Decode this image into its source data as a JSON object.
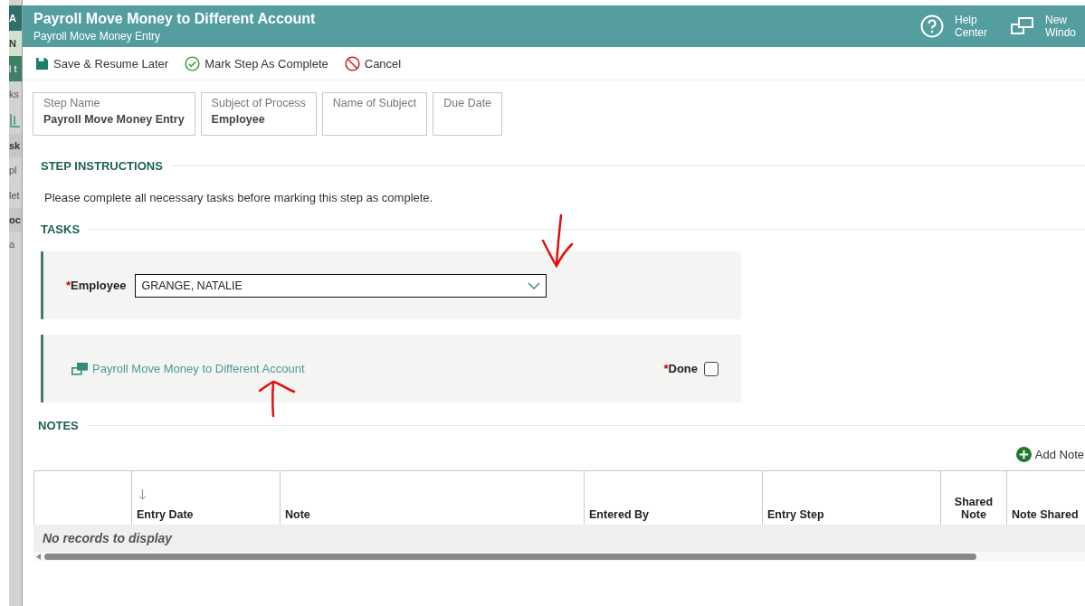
{
  "background_app": {
    "fragments": [
      {
        "text": "A",
        "kind": "header"
      },
      {
        "text": "N",
        "kind": "menu"
      },
      {
        "text": "l t",
        "kind": "band"
      },
      {
        "text": "ks",
        "kind": "item"
      },
      {
        "kind": "icon"
      },
      {
        "text": "sk",
        "kind": "bold"
      },
      {
        "text": "pl",
        "kind": "item"
      },
      {
        "text": "let",
        "kind": "item"
      },
      {
        "text": "oc",
        "kind": "bold"
      },
      {
        "text": "a",
        "kind": "item"
      }
    ]
  },
  "window": {
    "title": "Payroll Move Money to Different Account",
    "subtitle": "Payroll Move Money Entry"
  },
  "header_actions": [
    {
      "kind": "help",
      "lines": [
        "Help",
        "Center"
      ]
    },
    {
      "kind": "window",
      "lines": [
        "New",
        "Windo"
      ]
    }
  ],
  "toolbar": [
    {
      "kind": "save",
      "label": "Save & Resume Later"
    },
    {
      "kind": "complete",
      "label": "Mark Step As Complete"
    },
    {
      "kind": "cancel",
      "label": "Cancel"
    }
  ],
  "info_fields": [
    {
      "label": "Step Name",
      "value": "Payroll Move Money Entry"
    },
    {
      "label": "Subject of Process",
      "value": "Employee"
    },
    {
      "label": "Name of Subject"
    },
    {
      "label": "Due Date"
    }
  ],
  "step_instructions": {
    "heading": "STEP INSTRUCTIONS",
    "text": "Please complete all necessary tasks before marking this step as complete."
  },
  "tasks": {
    "heading": "TASKS",
    "employee": {
      "required_mark": "*",
      "label": "Employee",
      "value": "GRANGE, NATALIE"
    },
    "link": {
      "label": "Payroll Move Money to Different Account",
      "done_required_mark": "*",
      "done_label": "Done",
      "checked": false
    }
  },
  "notes": {
    "heading": "NOTES",
    "add_label": "Add Note",
    "columns": [
      {
        "sorted": false
      },
      {
        "label": "Entry Date",
        "sorted": true
      },
      {
        "label": "Note",
        "sorted": false
      },
      {
        "label": "Entered By",
        "sorted": false
      },
      {
        "label": "Entry Step",
        "sorted": false
      },
      {
        "label": "Shared Note",
        "sorted": false
      },
      {
        "label": "Note Shared",
        "sorted": false
      }
    ],
    "empty_text": "No records to display"
  }
}
